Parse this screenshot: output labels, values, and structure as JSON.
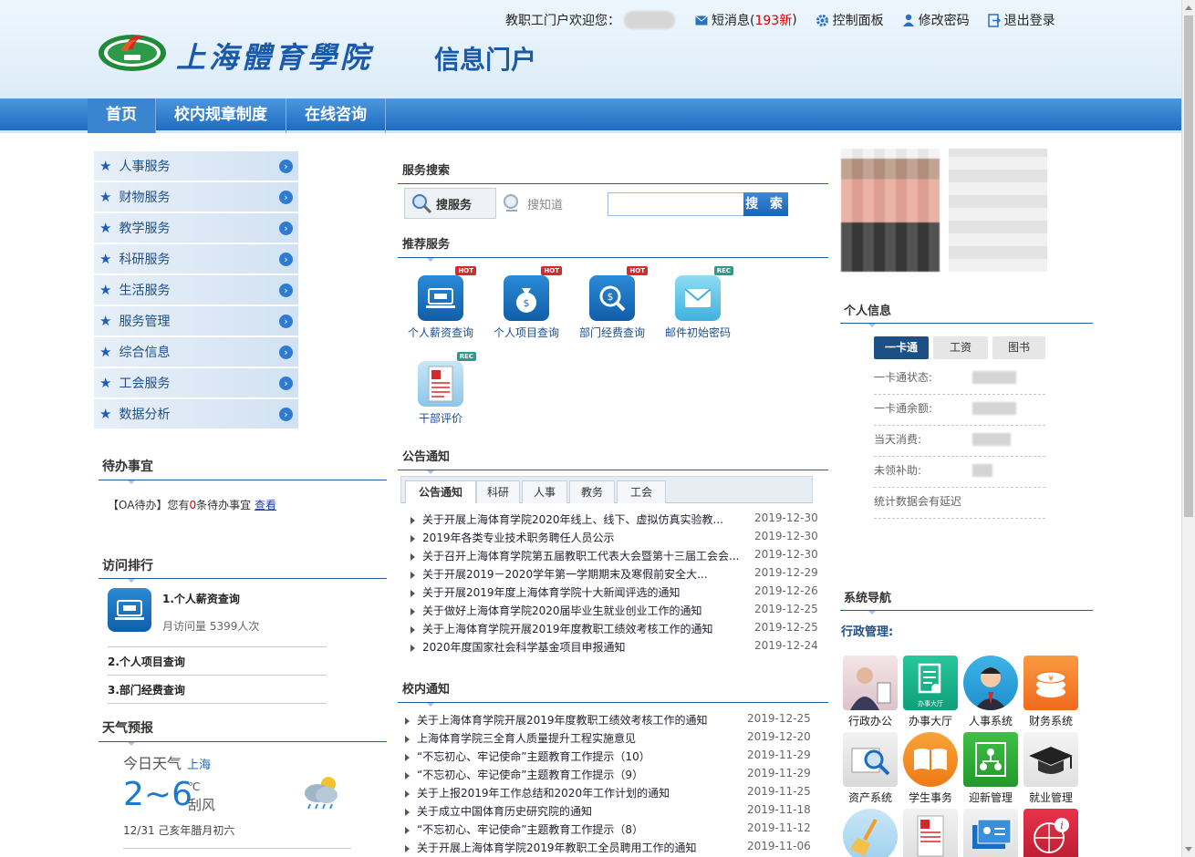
{
  "header": {
    "school_name": "上海體育學院",
    "portal_name": "信息门户",
    "welcome": "教职工门户欢迎您：",
    "messages_label": "短消息(",
    "messages_count": "193新",
    "messages_close": ")",
    "control_panel": "控制面板",
    "change_password": "修改密码",
    "logout": "退出登录"
  },
  "nav": [
    "首页",
    "校内规章制度",
    "在线咨询"
  ],
  "menu": [
    "人事服务",
    "财物服务",
    "教学服务",
    "科研服务",
    "生活服务",
    "服务管理",
    "综合信息",
    "工会服务",
    "数据分析"
  ],
  "todo": {
    "title": "待办事宜",
    "prefix": "【OA待办】您有",
    "count": "0",
    "suffix": "条待办事宜",
    "link": "查看"
  },
  "ranking": {
    "title": "访问排行",
    "first_name": "1.个人薪资查询",
    "first_count": "月访问量 5399人次",
    "second": "2.个人项目查询",
    "third": "3.部门经费查询"
  },
  "weather": {
    "title": "天气预报",
    "today": "今日天气",
    "city": "上海",
    "temp": "2~6",
    "unit": "℃",
    "wind": "刮风",
    "date": "12/31 己亥年腊月初六"
  },
  "search": {
    "title": "服务搜索",
    "tab_service": "搜服务",
    "tab_knowledge": "搜知道",
    "button": "搜 索",
    "placeholder": ""
  },
  "recommend": {
    "title": "推荐服务",
    "items": [
      {
        "label": "个人薪资查询",
        "badge": "HOT"
      },
      {
        "label": "个人项目查询",
        "badge": "HOT"
      },
      {
        "label": "部门经费查询",
        "badge": "HOT"
      },
      {
        "label": "邮件初始密码",
        "badge": "REC"
      },
      {
        "label": "干部评价",
        "badge": "REC"
      }
    ]
  },
  "notice": {
    "title": "公告通知",
    "tabs": [
      "公告通知",
      "科研",
      "人事",
      "教务",
      "工会"
    ],
    "items": [
      {
        "title": "关于开展上海体育学院2020年线上、线下、虚拟仿真实验教...",
        "date": "2019-12-30"
      },
      {
        "title": "2019年各类专业技术职务聘任人员公示",
        "date": "2019-12-30"
      },
      {
        "title": "关于召开上海体育学院第五届教职工代表大会暨第十三届工会会...",
        "date": "2019-12-30"
      },
      {
        "title": "关于开展2019－2020学年第一学期期末及寒假前安全大...",
        "date": "2019-12-29"
      },
      {
        "title": "关于开展2019年度上海体育学院十大新闻评选的通知",
        "date": "2019-12-26"
      },
      {
        "title": "关于做好上海体育学院2020届毕业生就业创业工作的通知",
        "date": "2019-12-25"
      },
      {
        "title": "关于上海体育学院开展2019年度教职工绩效考核工作的通知",
        "date": "2019-12-25"
      },
      {
        "title": "2020年度国家社会科学基金项目申报通知",
        "date": "2019-12-24"
      }
    ]
  },
  "campus": {
    "title": "校内通知",
    "items": [
      {
        "title": "关于上海体育学院开展2019年度教职工绩效考核工作的通知",
        "date": "2019-12-25"
      },
      {
        "title": "上海体育学院三全育人质量提升工程实施意见",
        "date": "2019-12-20"
      },
      {
        "title": "“不忘初心、牢记使命”主题教育工作提示（10）",
        "date": "2019-11-29"
      },
      {
        "title": "“不忘初心、牢记使命”主题教育工作提示（9）",
        "date": "2019-11-29"
      },
      {
        "title": "关于上报2019年工作总结和2020年工作计划的通知",
        "date": "2019-11-25"
      },
      {
        "title": "关于成立中国体育历史研究院的通知",
        "date": "2019-11-18"
      },
      {
        "title": "“不忘初心、牢记使命”主题教育工作提示（8）",
        "date": "2019-11-12"
      },
      {
        "title": "关于开展上海体育学院2019年教职工全员聘用工作的通知",
        "date": "2019-11-06"
      }
    ]
  },
  "personal": {
    "title": "个人信息",
    "tabs": [
      "一卡通",
      "工资",
      "图书"
    ],
    "rows": [
      "一卡通状态:",
      "一卡通余额:",
      "当天消费:",
      "未领补助:",
      "统计数据会有延迟"
    ]
  },
  "sysnav": {
    "title": "系统导航",
    "group": "行政管理:",
    "apps": [
      "行政办公",
      "办事大厅",
      "人事系统",
      "财务系统",
      "资产系统",
      "学生事务",
      "迎新管理",
      "就业管理"
    ],
    "hall_caption": "办事大厅"
  },
  "colors": {
    "nav_blue": "#1f6cc2",
    "link_blue": "#1a4f8f",
    "hot_red": "#d42a2a",
    "rec_teal": "#2a9a8a"
  }
}
